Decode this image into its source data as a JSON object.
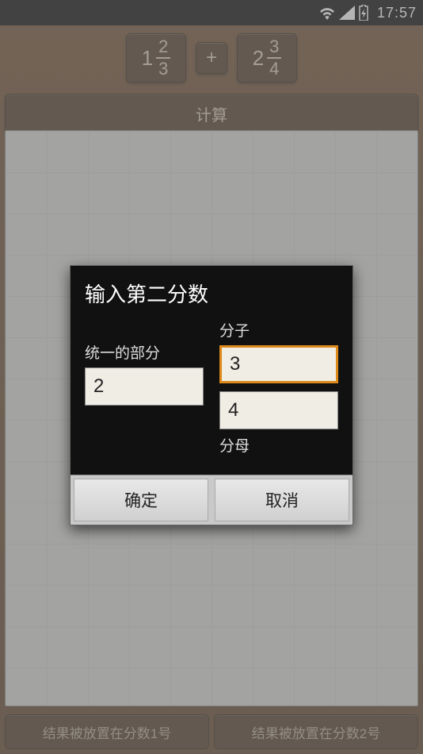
{
  "statusbar": {
    "time": "17:57"
  },
  "fraction_row": {
    "frac1": {
      "whole": "1",
      "numerator": "2",
      "denominator": "3"
    },
    "operator": "+",
    "frac2": {
      "whole": "2",
      "numerator": "3",
      "denominator": "4"
    }
  },
  "calculate_label": "计算",
  "bottom": {
    "left": "结果被放置在分数1号",
    "right": "结果被放置在分数2号"
  },
  "dialog": {
    "title": "输入第二分数",
    "whole_label": "统一的部分",
    "numerator_label": "分子",
    "denominator_label": "分母",
    "whole_value": "2",
    "numerator_value": "3",
    "denominator_value": "4",
    "ok": "确定",
    "cancel": "取消"
  }
}
